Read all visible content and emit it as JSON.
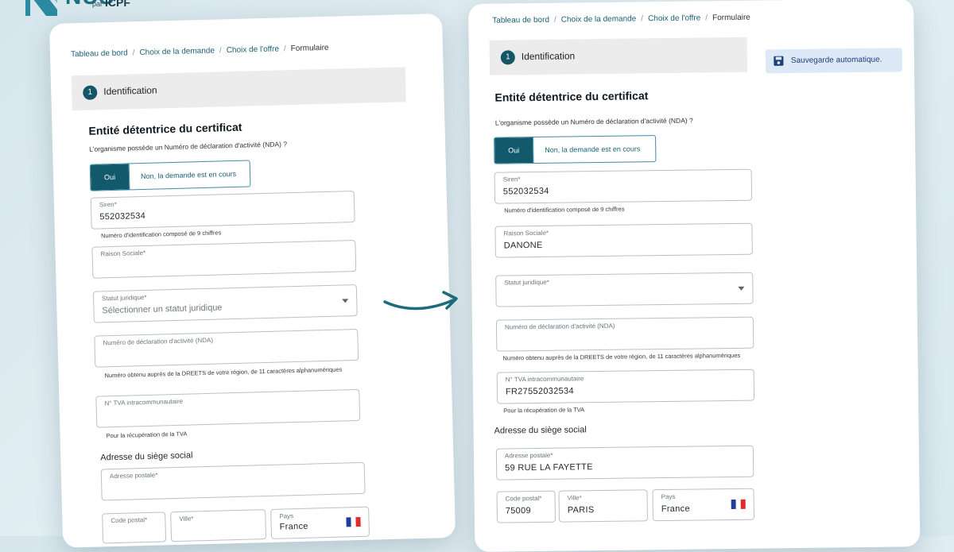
{
  "logo": {
    "brand": "NUS",
    "par": "par",
    "partner": "ICPF"
  },
  "breadcrumb": [
    "Tableau de bord",
    "Choix de la demande",
    "Choix de l'offre",
    "Formulaire"
  ],
  "step": {
    "number": "1",
    "label": "Identification"
  },
  "autosave": {
    "label": "Sauvegarde automatique."
  },
  "form": {
    "section_title": "Entité détentrice du certificat",
    "nda_question": "L'organisme possède un Numéro de déclaration d'activité (NDA) ?",
    "nda_yes": "Oui",
    "nda_no": "Non, la demande est en cours",
    "siren_label": "Siren*",
    "siren_hint": "Numéro d'identification composé de 9 chiffres",
    "raison_label": "Raison Sociale*",
    "statut_label": "Statut juridique*",
    "statut_placeholder": "Sélectionner un statut juridique",
    "nda_label": "Numéro de déclaration d'activité (NDA)",
    "nda_hint": "Numéro obtenu auprès de la DREETS de votre région, de 11 caractères alphanumériques",
    "tva_label": "N° TVA intracommunautaire",
    "tva_hint": "Pour la récupération de la TVA",
    "address_title": "Adresse du siège social",
    "adresse_label": "Adresse postale*",
    "cp_label": "Code postal*",
    "ville_label": "Ville*",
    "pays_label": "Pays",
    "pays_value": "France"
  },
  "left_values": {
    "siren": "552032534"
  },
  "right_values": {
    "siren": "552032534",
    "raison": "DANONE",
    "tva": "FR27552032534",
    "adresse": "59 RUE LA FAYETTE",
    "cp": "75009",
    "ville": "PARIS"
  },
  "colors": {
    "primary": "#12596b",
    "link": "#1b5f74",
    "flag_blue": "#1f3f9a",
    "flag_red": "#e02b2b"
  },
  "icons": {
    "save": "floppy-disk-icon",
    "arrow": "curved-arrow-icon"
  }
}
